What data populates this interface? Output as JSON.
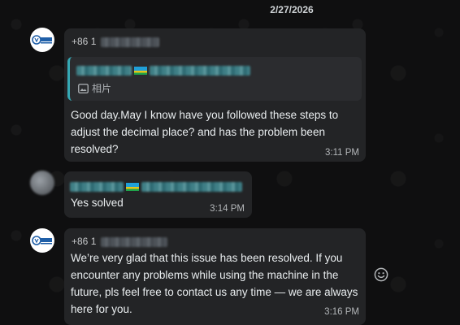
{
  "date_divider": "2/27/2026",
  "colors": {
    "background": "#0f0f10",
    "bubble": "#232426",
    "quote_bar": "#35a8b4"
  },
  "messages": [
    {
      "sender_prefix": "+86 1",
      "avatar": "wecanmed-logo",
      "quote_media_label": "相片",
      "text": "Good day.May I know have you followed these steps to adjust the decimal place? and has the problem been resolved?",
      "time": "3:11 PM"
    },
    {
      "sender_prefix": "",
      "avatar": "blurred-photo",
      "text": "Yes solved",
      "time": "3:14 PM"
    },
    {
      "sender_prefix": "+86 1",
      "avatar": "wecanmed-logo",
      "text": "We’re very glad that this issue has been resolved. If you encounter any problems while using the machine in the future, pls feel free to contact us any time — we are always here for you.",
      "time": "3:16 PM"
    }
  ],
  "icons": {
    "reaction": "smiley-icon",
    "image": "image-icon"
  }
}
